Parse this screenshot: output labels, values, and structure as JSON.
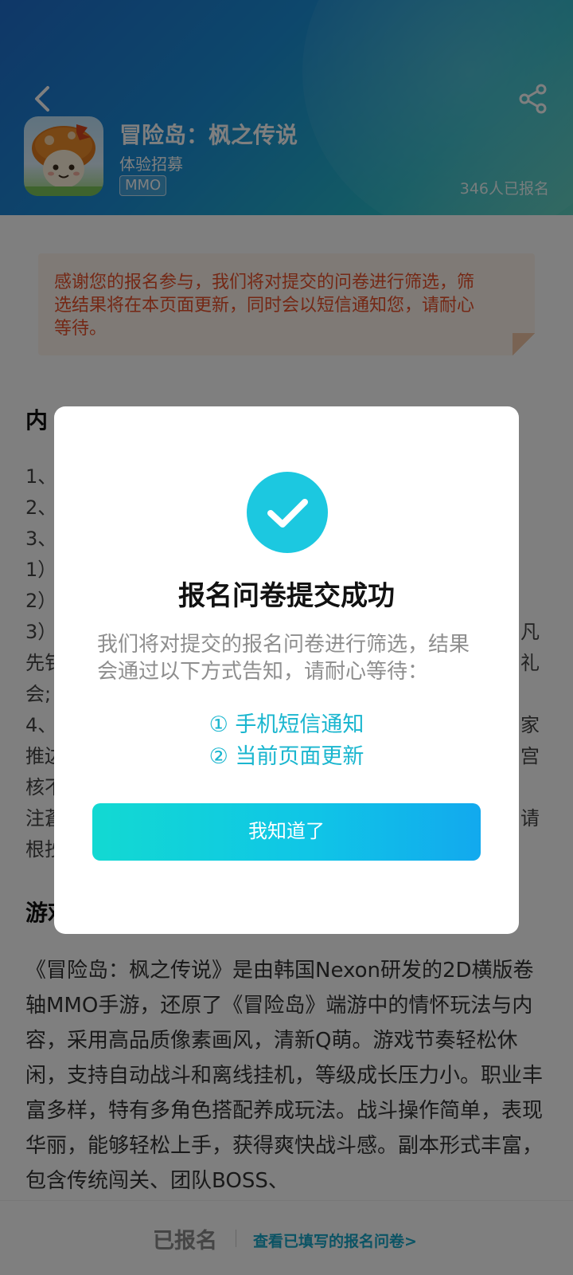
{
  "header": {
    "app_title": "冒险岛：枫之传说",
    "subtitle": "体验招募",
    "tag": "MMO",
    "signup_count": "346人已报名",
    "back_icon": "chevron-left-icon",
    "share_icon": "share-icon"
  },
  "notice": {
    "lines": [
      "感谢您的报名参与，我们将对提交的问卷进行筛选，筛",
      "选结果将在本页面更新，同时会以短信通知您，请耐心",
      "等待。"
    ]
  },
  "content": {
    "heading_fragment": "内",
    "left_fragments": [
      "1、",
      "2、",
      "3、",
      "1）",
      "2）",
      "3）",
      "先钅",
      "会;",
      "4、",
      "推边",
      "核不",
      "注蒼",
      "根抄"
    ],
    "right_fragments": [
      "凡",
      "礼",
      "家",
      "宫",
      "请"
    ],
    "section_heading": "游戏介绍",
    "intro_text": "《冒险岛：枫之传说》是由韩国Nexon研发的2D横版卷轴MMO手游，还原了《冒险岛》端游中的情怀玩法与内容，采用高品质像素画风，清新Q萌。游戏节奏轻松休闲，支持自动战斗和离线挂机，等级成长压力小。职业丰富多样，特有多角色搭配养成玩法。战斗操作简单，表现华丽，能够轻松上手，获得爽快战斗感。副本形式丰富，包含传统闯关、团队BOSS、"
  },
  "bottom_bar": {
    "status": "已报名",
    "link": "查看已填写的报名问卷>"
  },
  "modal": {
    "icon": "check-circle-icon",
    "title": "报名问卷提交成功",
    "description": "我们将对提交的报名问卷进行筛选，结果会通过以下方式告知，请耐心等待：",
    "notify_items": [
      "① 手机短信通知",
      "② 当前页面更新"
    ],
    "ok_label": "我知道了"
  },
  "colors": {
    "accent": "#1cc8e0",
    "notice_text": "#e8502a",
    "link": "#16a7c9"
  }
}
